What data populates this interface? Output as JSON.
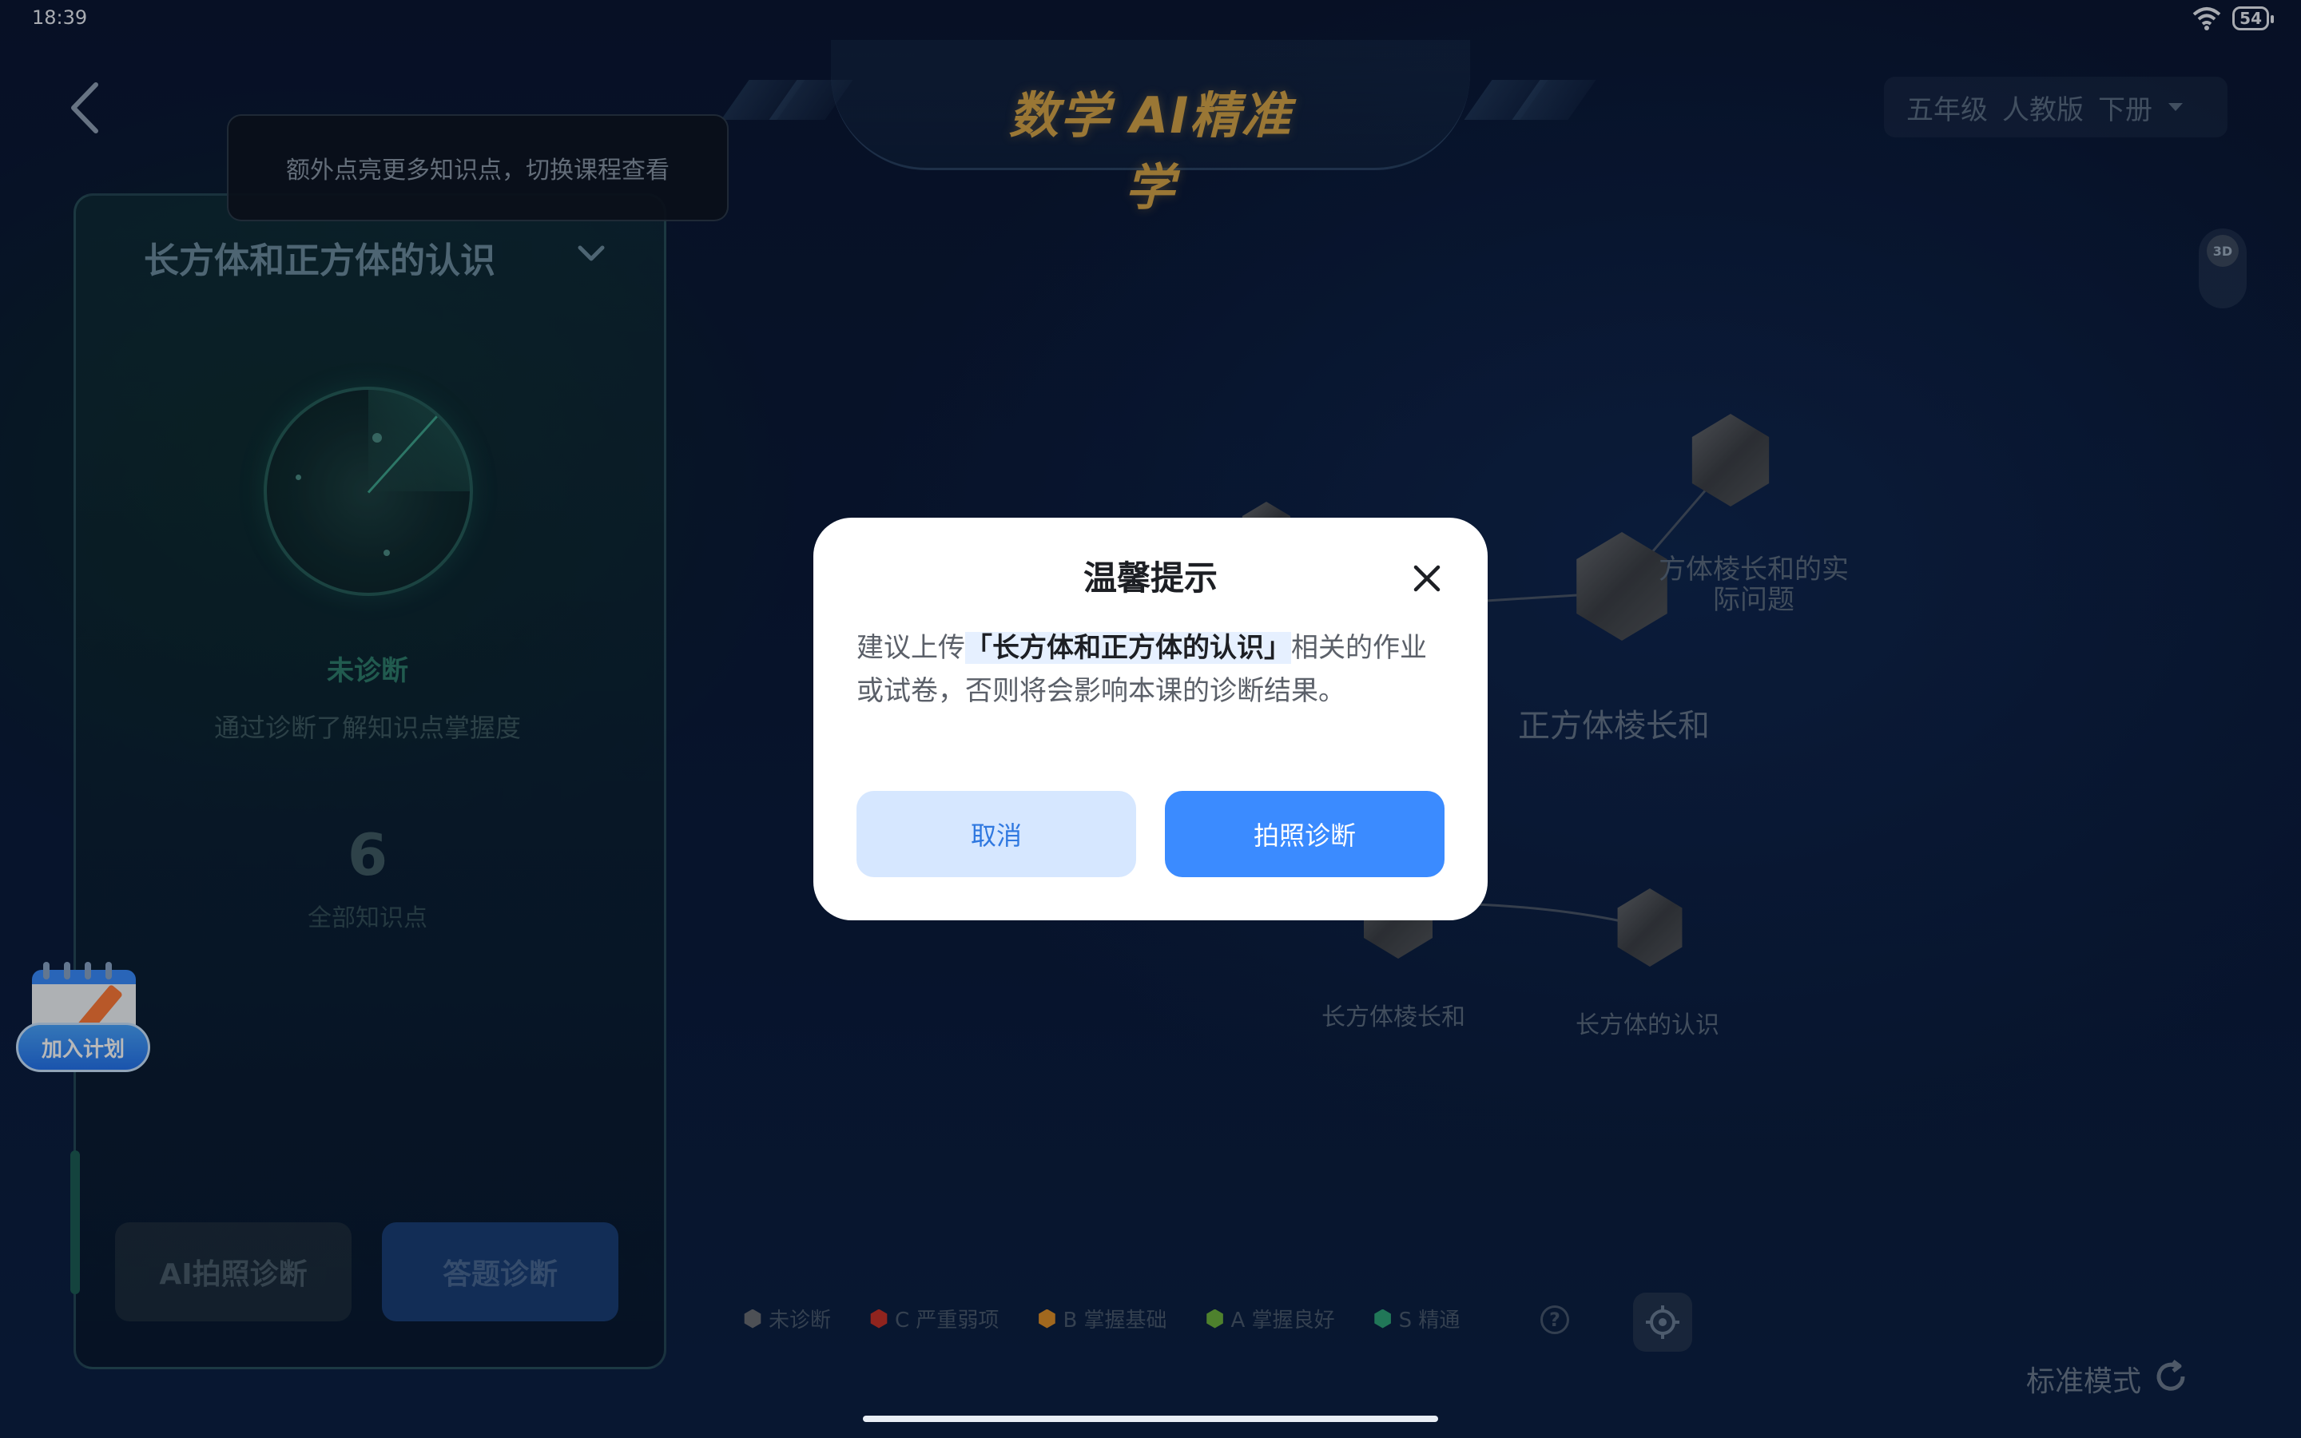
{
  "status_bar": {
    "time": "18:39",
    "battery": "54"
  },
  "header": {
    "app_title": "数学 AI精准学",
    "grade": "五年级",
    "edition": "人教版",
    "volume": "下册",
    "btn_3d": "3D"
  },
  "left_panel": {
    "tooltip": "额外点亮更多知识点，切换课程查看",
    "course_title": "长方体和正方体的认识",
    "diagnosis_status": "未诊断",
    "diagnosis_desc": "通过诊断了解知识点掌握度",
    "kp_count": "6",
    "kp_label": "全部知识点",
    "btn_ai_photo": "AI拍照诊断",
    "btn_answer": "答题诊断"
  },
  "plan_float": {
    "label": "加入计划"
  },
  "graph": {
    "nodes": [
      {
        "label": "方体棱长和的实\n际问题"
      },
      {
        "label": "正方体棱长和"
      },
      {
        "label": "长方体棱长和"
      },
      {
        "label": "长方体的认识"
      }
    ]
  },
  "legend": {
    "items": [
      {
        "label": "未诊断",
        "color": "#6b6f76"
      },
      {
        "label": "C 严重弱项",
        "color": "#c8322a"
      },
      {
        "label": "B 掌握基础",
        "color": "#e0902a"
      },
      {
        "label": "A 掌握良好",
        "color": "#6db33f"
      },
      {
        "label": "S 精通",
        "color": "#2fa57a"
      }
    ]
  },
  "footer": {
    "mode": "标准模式"
  },
  "dialog": {
    "title": "温馨提示",
    "body_pre": "建议上传",
    "body_highlight": "「长方体和正方体的认识」",
    "body_post": "相关的作业或试卷，否则将会影响本课的诊断结果。",
    "btn_cancel": "取消",
    "btn_confirm": "拍照诊断"
  },
  "colors": {
    "accent": "#3b8bff",
    "title_gold": "#d6a64a"
  }
}
